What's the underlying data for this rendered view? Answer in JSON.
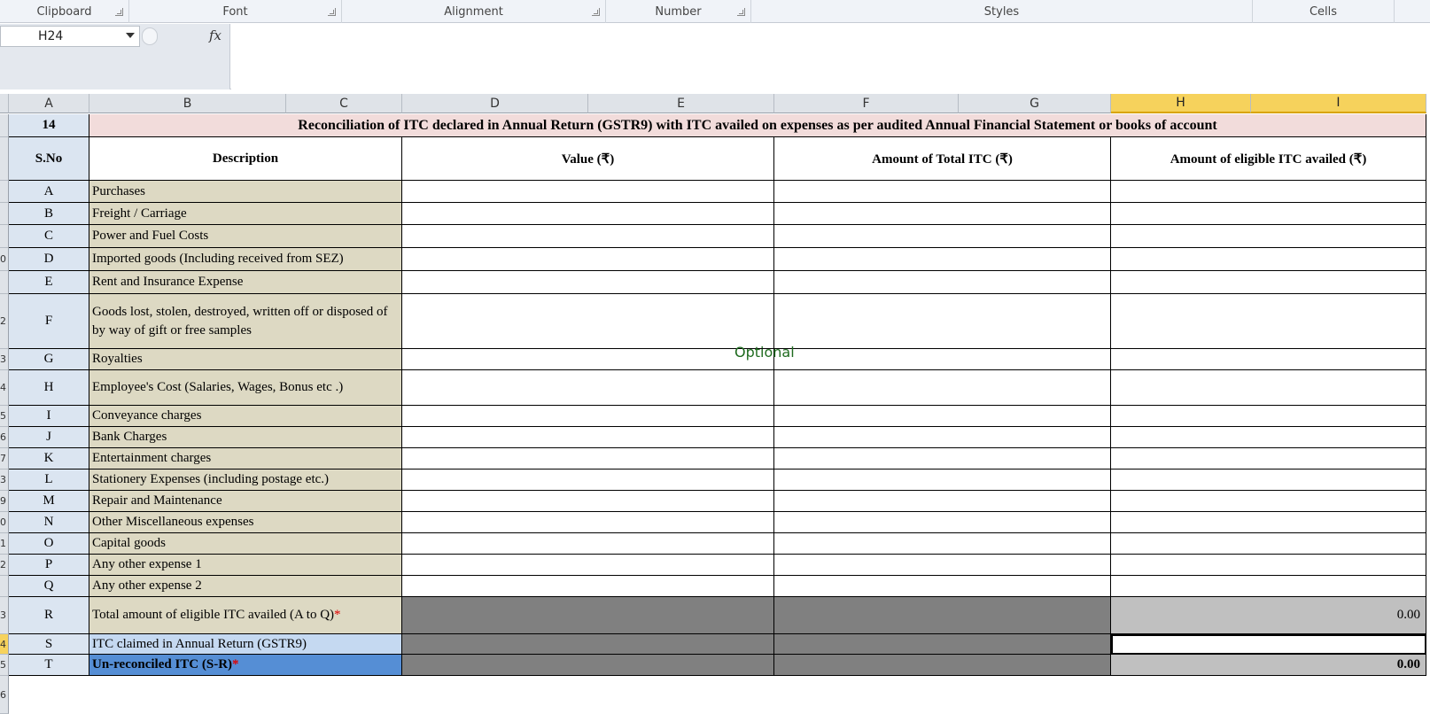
{
  "ribbon": {
    "groups": [
      "Clipboard",
      "Font",
      "Alignment",
      "Number",
      "Styles",
      "Cells"
    ]
  },
  "formula_bar": {
    "name_box": "H24",
    "fx_label": "fx",
    "content": ""
  },
  "columns": [
    "A",
    "B",
    "C",
    "D",
    "E",
    "F",
    "G",
    "H",
    "I"
  ],
  "selected_column": "H",
  "sheet": {
    "section_no": "14",
    "title": "Reconciliation of ITC declared in Annual Return (GSTR9) with ITC availed on expenses as per audited Annual Financial Statement or books of account",
    "headers": {
      "sno": "S.No",
      "description": "Description",
      "value": "Value (₹)",
      "total_itc": "Amount of Total ITC (₹)",
      "eligible_itc": "Amount of eligible ITC availed (₹)"
    },
    "rows": [
      {
        "sno": "A",
        "desc": "Purchases"
      },
      {
        "sno": "B",
        "desc": "Freight / Carriage"
      },
      {
        "sno": "C",
        "desc": "Power and Fuel Costs"
      },
      {
        "sno": "D",
        "desc": "Imported goods (Including received from SEZ)"
      },
      {
        "sno": "E",
        "desc": "Rent and Insurance Expense"
      },
      {
        "sno": "F",
        "desc": "Goods lost, stolen, destroyed, written off or disposed of by way of gift or free samples"
      },
      {
        "sno": "G",
        "desc": "Royalties"
      },
      {
        "sno": "H",
        "desc": "Employee's Cost (Salaries, Wages, Bonus etc .)"
      },
      {
        "sno": "I",
        "desc": "Conveyance charges"
      },
      {
        "sno": "J",
        "desc": "Bank Charges"
      },
      {
        "sno": "K",
        "desc": "Entertainment charges"
      },
      {
        "sno": "L",
        "desc": "Stationery Expenses (including postage etc.)"
      },
      {
        "sno": "M",
        "desc": "Repair and Maintenance"
      },
      {
        "sno": "N",
        "desc": "Other Miscellaneous expenses"
      },
      {
        "sno": "O",
        "desc": "Capital goods"
      },
      {
        "sno": "P",
        "desc": "Any other expense 1"
      },
      {
        "sno": "Q",
        "desc": "Any other expense 2"
      }
    ],
    "total_row": {
      "sno": "R",
      "desc": "Total amount of eligible ITC availed (A to Q)",
      "req": "*",
      "value": "0.00"
    },
    "claimed_row": {
      "sno": "S",
      "desc": "ITC claimed in Annual Return (GSTR9)"
    },
    "unreconciled_row": {
      "sno": "T",
      "desc": "Un-reconciled ITC (S-R)",
      "req": "*",
      "value": "0.00"
    },
    "watermark": "Optional"
  },
  "row_numbers": [
    "",
    "",
    "",
    "",
    "",
    "0",
    "",
    "2",
    "3",
    "4",
    "5",
    "6",
    "7",
    "3",
    "9",
    "0",
    "1",
    "2",
    "",
    "3",
    "4",
    "5",
    "6"
  ]
}
